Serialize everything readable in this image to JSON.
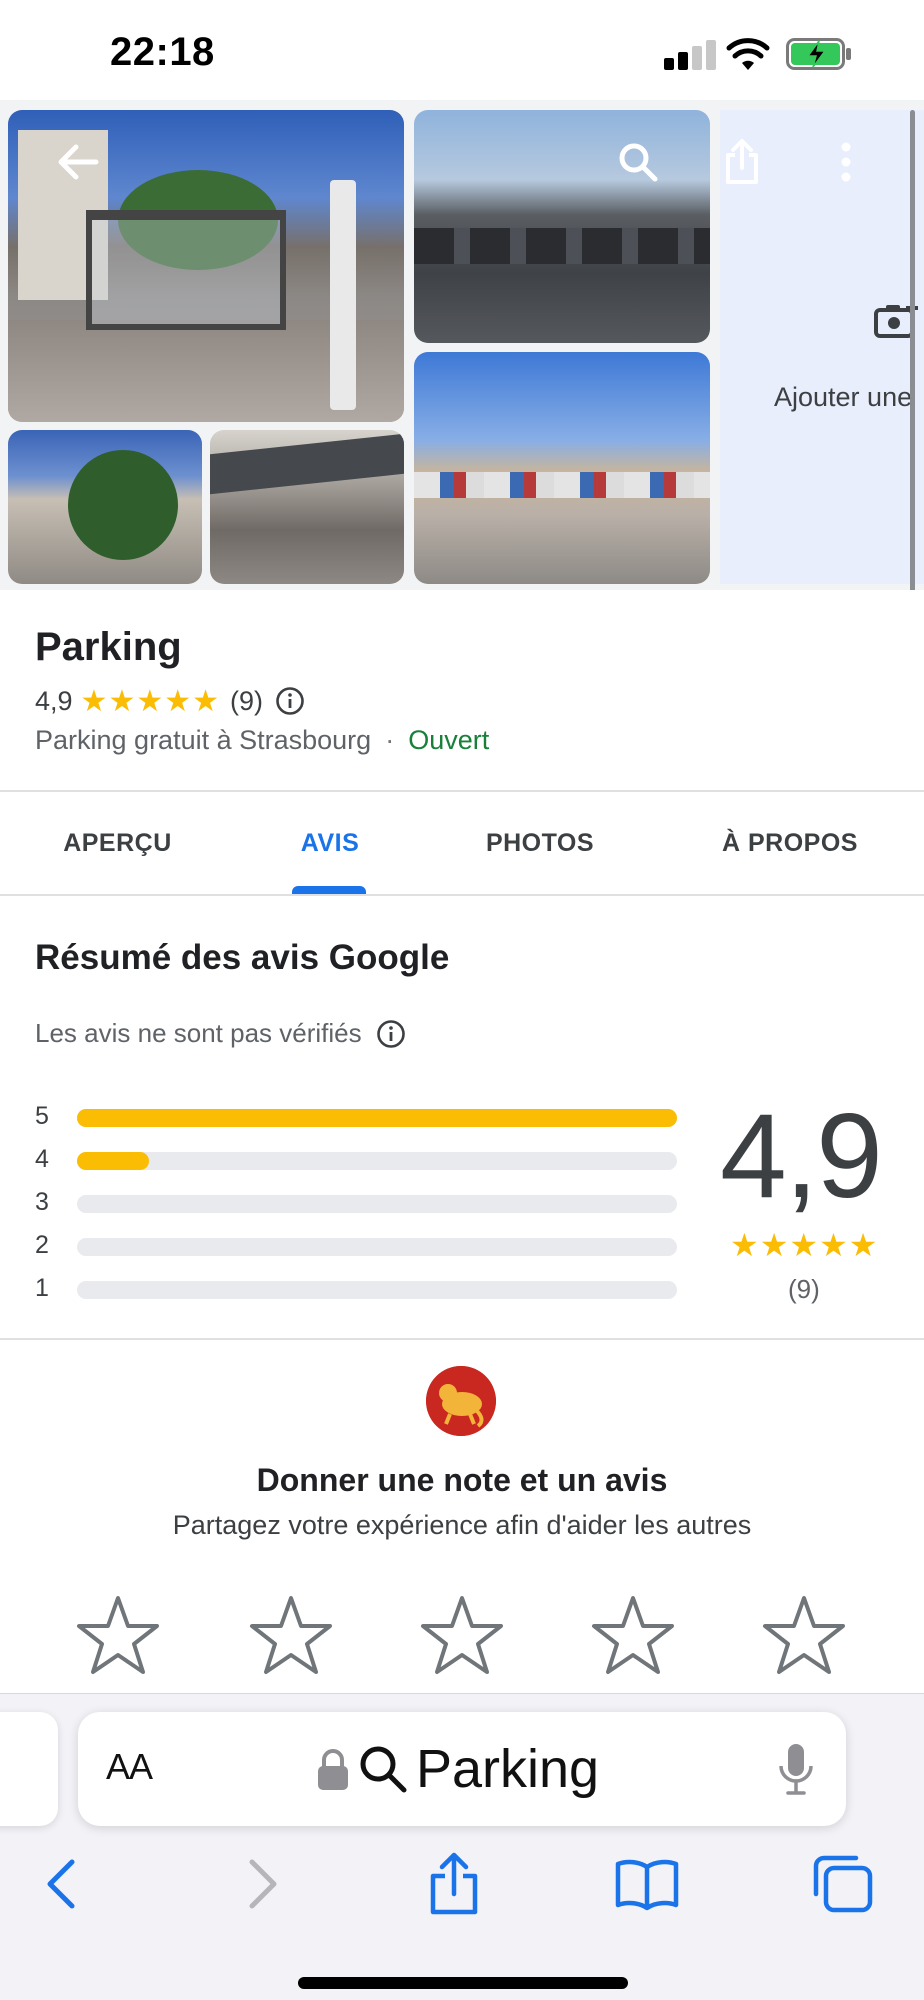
{
  "status_bar": {
    "time": "22:18"
  },
  "gallery": {
    "add_photo_label": "Ajouter une"
  },
  "place": {
    "name": "Parking",
    "rating": "4,9",
    "rating_stars": "★★★★★",
    "review_count": "(9)",
    "category": "Parking gratuit à Strasbourg",
    "separator": "·",
    "open_status": "Ouvert"
  },
  "tabs": [
    {
      "label": "APERÇU",
      "active": false
    },
    {
      "label": "AVIS",
      "active": true
    },
    {
      "label": "PHOTOS",
      "active": false
    },
    {
      "label": "À PROPOS",
      "active": false
    }
  ],
  "summary": {
    "title": "Résumé des avis Google",
    "unverified_note": "Les avis ne sont pas vérifiés",
    "distribution": [
      {
        "stars": "5",
        "fraction": 1.0
      },
      {
        "stars": "4",
        "fraction": 0.12
      },
      {
        "stars": "3",
        "fraction": 0
      },
      {
        "stars": "2",
        "fraction": 0
      },
      {
        "stars": "1",
        "fraction": 0
      }
    ],
    "average": "4,9",
    "average_stars": "★★★★★",
    "count": "(9)"
  },
  "write_review": {
    "title": "Donner une note et un avis",
    "subtitle": "Partagez votre expérience afin d'aider les autres",
    "star_count": 5
  },
  "browser": {
    "text_size_label": "AA",
    "address_text": "Parking"
  },
  "colors": {
    "accent_blue": "#1a73e8",
    "star_yellow": "#fbbc04",
    "open_green": "#188038"
  },
  "icons": {
    "back": "arrow-left-icon",
    "search": "search-icon",
    "share": "share-icon",
    "more": "more-vertical-icon",
    "camera": "add-photo-camera-icon",
    "info": "info-icon",
    "lock": "lock-icon",
    "mic": "microphone-icon"
  }
}
